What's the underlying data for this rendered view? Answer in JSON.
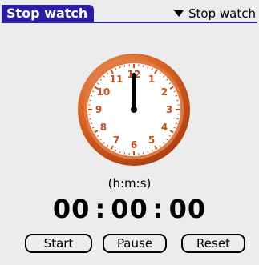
{
  "title": "Stop watch",
  "category_selector": {
    "label": "Stop watch",
    "icon": "dropdown-triangle-icon"
  },
  "clock": {
    "numbers": [
      "12",
      "1",
      "2",
      "3",
      "4",
      "5",
      "6",
      "7",
      "8",
      "9",
      "10",
      "11"
    ],
    "hand_hour": 12,
    "colors": {
      "rim": "#c8501a",
      "rim_light": "#f0a070",
      "face": "#ffffff",
      "numerals": "#c8501a",
      "hand": "#000000"
    }
  },
  "caption": "(h:m:s)",
  "timer": {
    "hours": "00",
    "minutes": "00",
    "seconds": "00",
    "separator": ":"
  },
  "buttons": {
    "start": "Start",
    "pause": "Pause",
    "reset": "Reset"
  },
  "colors": {
    "accent": "#2a1fa0",
    "background": "#ececec"
  }
}
